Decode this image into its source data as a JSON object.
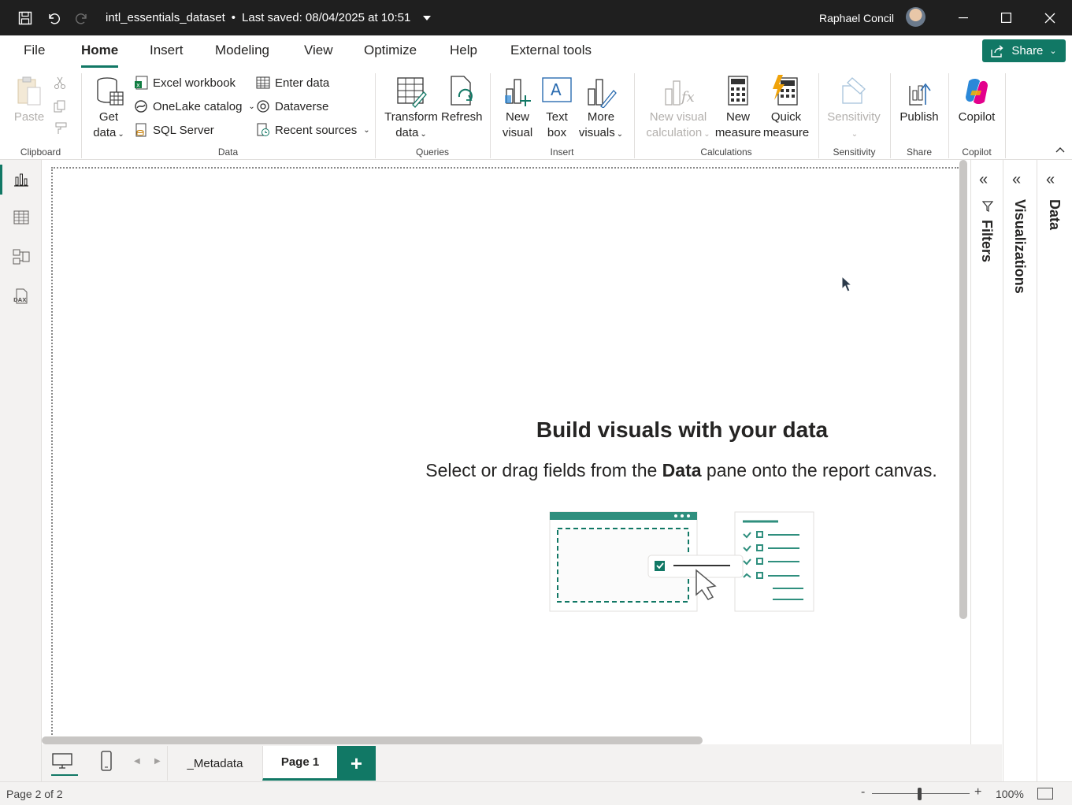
{
  "titlebar": {
    "file_name": "intl_essentials_dataset",
    "separator": "•",
    "saved_status": "Last saved: 08/04/2025 at 10:51",
    "user_name": "Raphael Concil"
  },
  "menu": {
    "tabs": [
      "File",
      "Home",
      "Insert",
      "Modeling",
      "View",
      "Optimize",
      "Help",
      "External tools"
    ],
    "active": "Home",
    "share_label": "Share"
  },
  "ribbon": {
    "clipboard": {
      "label": "Clipboard",
      "paste": "Paste"
    },
    "data": {
      "label": "Data",
      "get_data_1": "Get",
      "get_data_2": "data",
      "excel": "Excel workbook",
      "onelake": "OneLake catalog",
      "sql": "SQL Server",
      "enter_data": "Enter data",
      "dataverse": "Dataverse",
      "recent": "Recent sources"
    },
    "queries": {
      "label": "Queries",
      "transform_1": "Transform",
      "transform_2": "data",
      "refresh": "Refresh"
    },
    "insert": {
      "label": "Insert",
      "new_visual_1": "New",
      "new_visual_2": "visual",
      "text_box_1": "Text",
      "text_box_2": "box",
      "more_visuals_1": "More",
      "more_visuals_2": "visuals"
    },
    "calculations": {
      "label": "Calculations",
      "nvc_1": "New visual",
      "nvc_2": "calculation",
      "new_measure_1": "New",
      "new_measure_2": "measure",
      "quick_measure_1": "Quick",
      "quick_measure_2": "measure"
    },
    "sensitivity": {
      "label": "Sensitivity",
      "button": "Sensitivity"
    },
    "share": {
      "label": "Share",
      "publish": "Publish"
    },
    "copilot": {
      "label": "Copilot",
      "button": "Copilot"
    }
  },
  "canvas": {
    "empty_title": "Build visuals with your data",
    "empty_sub_before": "Select or drag fields from the ",
    "empty_sub_bold": "Data",
    "empty_sub_after": " pane onto the report canvas."
  },
  "panes": {
    "filters": "Filters",
    "visualizations": "Visualizations",
    "data": "Data"
  },
  "pages": {
    "tabs": [
      "_Metadata",
      "Page 1"
    ],
    "active": "Page 1",
    "add_label": "+"
  },
  "status": {
    "page_info": "Page 2 of 2",
    "zoom": "100%",
    "zoom_minus": "-",
    "zoom_plus": "+"
  },
  "colors": {
    "accent": "#117865",
    "titlebar": "#1f1f1f"
  }
}
